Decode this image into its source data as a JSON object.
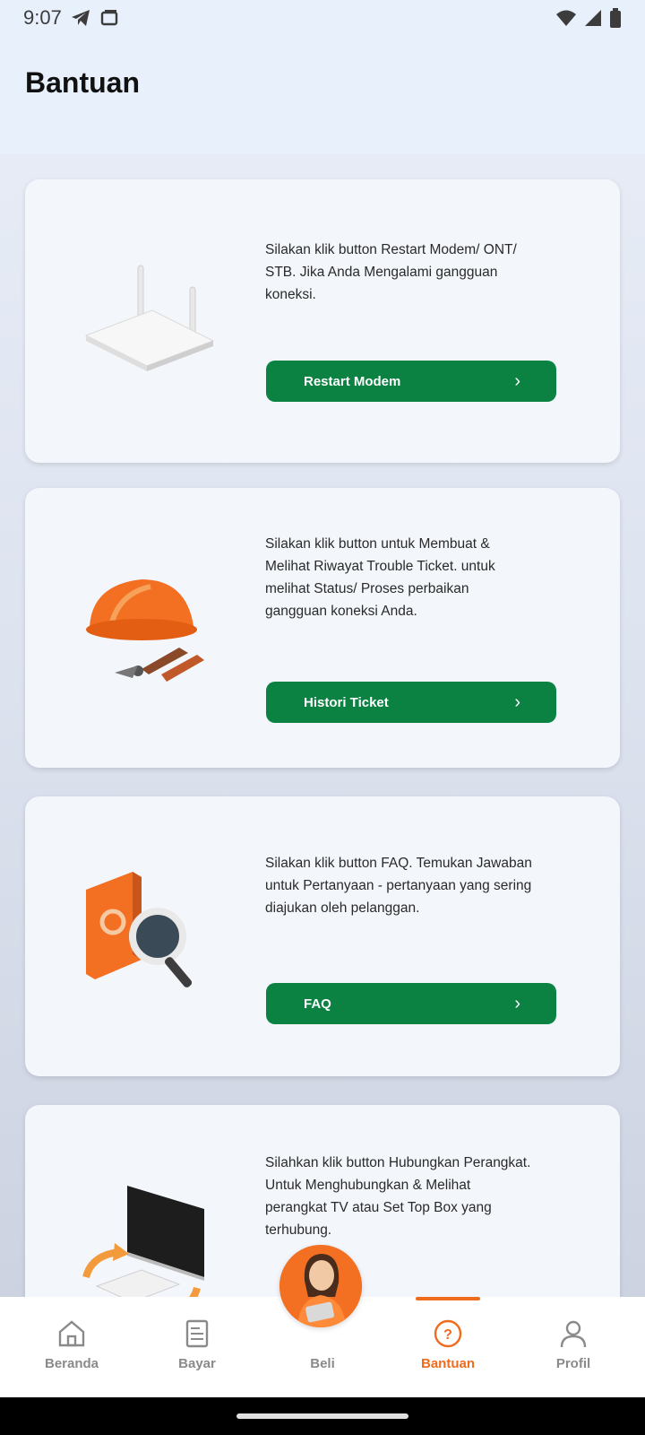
{
  "status": {
    "time": "9:07",
    "left_icons": [
      "telegram-icon",
      "screen-icon"
    ],
    "right_icons": [
      "wifi-icon",
      "signal-icon",
      "battery-icon"
    ]
  },
  "header": {
    "title": "Bantuan"
  },
  "cards": [
    {
      "illustration": "router-icon",
      "description": "Silakan klik button Restart Modem/ ONT/ STB. Jika  Anda Mengalami gangguan koneksi.",
      "button_label": "Restart Modem"
    },
    {
      "illustration": "helmet-tools-icon",
      "description": "Silakan klik button untuk Membuat & Melihat Riwayat Trouble Ticket. untuk melihat Status/ Proses perbaikan gangguan koneksi Anda.",
      "button_label": "Histori Ticket"
    },
    {
      "illustration": "book-magnifier-icon",
      "description": "Silakan klik button FAQ. Temukan Jawaban untuk Pertanyaan - pertanyaan yang sering diajukan oleh pelanggan.",
      "button_label": "FAQ"
    },
    {
      "illustration": "tv-connect-icon",
      "description": "Silahkan klik button Hubungkan Perangkat. Untuk Menghubungkan & Melihat perangkat TV atau Set Top Box yang terhubung.",
      "button_label": ""
    }
  ],
  "bottom_nav": {
    "items": [
      {
        "label": "Beranda",
        "icon": "home-icon"
      },
      {
        "label": "Bayar",
        "icon": "bill-icon"
      },
      {
        "label": "Beli",
        "icon": "agent-avatar"
      },
      {
        "label": "Bantuan",
        "icon": "help-icon"
      },
      {
        "label": "Profil",
        "icon": "user-icon"
      }
    ],
    "active": "Bantuan"
  },
  "colors": {
    "primary_green": "#0b8242",
    "accent_orange": "#ef6b1d",
    "header_bg": "#e8f0fb"
  }
}
